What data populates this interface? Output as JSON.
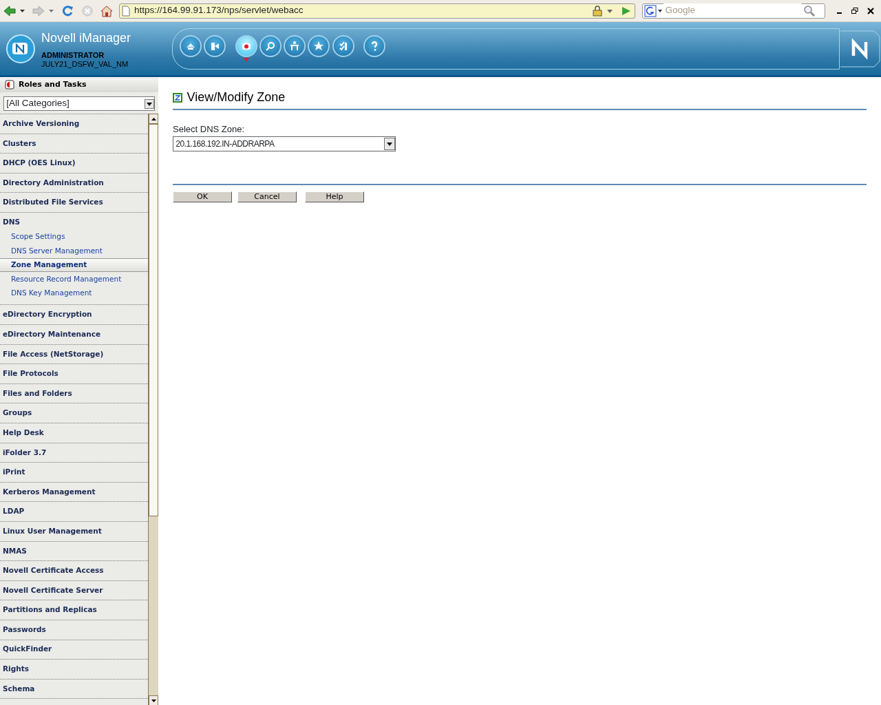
{
  "browser": {
    "url": "https://164.99.91.173/nps/servlet/webacc",
    "search": {
      "placeholder": "Google"
    }
  },
  "header": {
    "product": "Novell iManager",
    "user": "ADMINISTRATOR",
    "tree": "JULY21_DSFW_VAL_NM"
  },
  "toolbar": [
    {
      "kind": "home",
      "selected": false
    },
    {
      "kind": "exit",
      "selected": false
    },
    {
      "kind": "roles",
      "selected": true
    },
    {
      "kind": "view",
      "selected": false
    },
    {
      "kind": "config",
      "selected": false
    },
    {
      "kind": "favorites",
      "selected": false
    },
    {
      "kind": "tasks",
      "selected": false
    },
    {
      "kind": "help",
      "selected": false
    }
  ],
  "sidebar": {
    "title": "Roles and Tasks",
    "category_filter": "[All Categories]",
    "items": [
      {
        "label": "Archive Versioning"
      },
      {
        "label": "Clusters"
      },
      {
        "label": "DHCP (OES Linux)"
      },
      {
        "label": "Directory Administration"
      },
      {
        "label": "Distributed File Services"
      },
      {
        "label": "DNS",
        "children": [
          {
            "label": "Scope Settings",
            "selected": false
          },
          {
            "label": "DNS Server Management",
            "selected": false
          },
          {
            "label": "Zone Management",
            "selected": true
          },
          {
            "label": "Resource Record Management",
            "selected": false
          },
          {
            "label": "DNS Key Management",
            "selected": false
          }
        ]
      },
      {
        "label": "eDirectory Encryption"
      },
      {
        "label": "eDirectory Maintenance"
      },
      {
        "label": "File Access (NetStorage)"
      },
      {
        "label": "File Protocols"
      },
      {
        "label": "Files and Folders"
      },
      {
        "label": "Groups"
      },
      {
        "label": "Help Desk"
      },
      {
        "label": "iFolder 3.7"
      },
      {
        "label": "iPrint"
      },
      {
        "label": "Kerberos Management"
      },
      {
        "label": "LDAP"
      },
      {
        "label": "Linux User Management"
      },
      {
        "label": "NMAS"
      },
      {
        "label": "Novell Certificate Access"
      },
      {
        "label": "Novell Certificate Server"
      },
      {
        "label": "Partitions and Replicas"
      },
      {
        "label": "Passwords"
      },
      {
        "label": "QuickFinder"
      },
      {
        "label": "Rights"
      },
      {
        "label": "Schema"
      }
    ]
  },
  "content": {
    "title": "View/Modify Zone",
    "zone_label": "Select DNS Zone:",
    "zone_value": "20.1.168.192.IN-ADDRARPA",
    "buttons": [
      "OK",
      "Cancel",
      "Help"
    ]
  }
}
